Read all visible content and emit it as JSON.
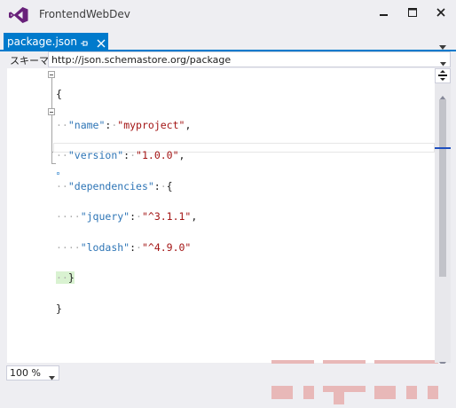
{
  "app": {
    "title": "FrontendWebDev",
    "brand_color": "#68217a",
    "accent_color": "#007acc"
  },
  "window_controls": {
    "minimize_icon": "minimize-icon",
    "maximize_icon": "maximize-icon",
    "close_icon": "close-icon"
  },
  "tab": {
    "title": "package.json",
    "pin_icon": "pin-icon",
    "close_icon": "close-icon",
    "menu_icon": "dropdown-icon"
  },
  "schema": {
    "label": "スキーマ:",
    "value": "http://json.schemastore.org/package"
  },
  "editor": {
    "lines": [
      [
        "{"
      ],
      [
        "··\"name\"",
        ":·",
        "\"myproject\"",
        ","
      ],
      [
        "··\"version\"",
        ":·",
        "\"1.0.0\"",
        ","
      ],
      [
        "··\"dependencies\"",
        ":·",
        "{"
      ],
      [
        "····\"jquery\"",
        ":·",
        "\"^3.1.1\"",
        ","
      ],
      [
        "····\"lodash\"",
        ":·",
        "\"^4.9.0\""
      ],
      [
        "··}"
      ],
      [
        "}"
      ]
    ],
    "watermark_text": "npm"
  },
  "statusbar": {
    "zoom": "100 %"
  }
}
